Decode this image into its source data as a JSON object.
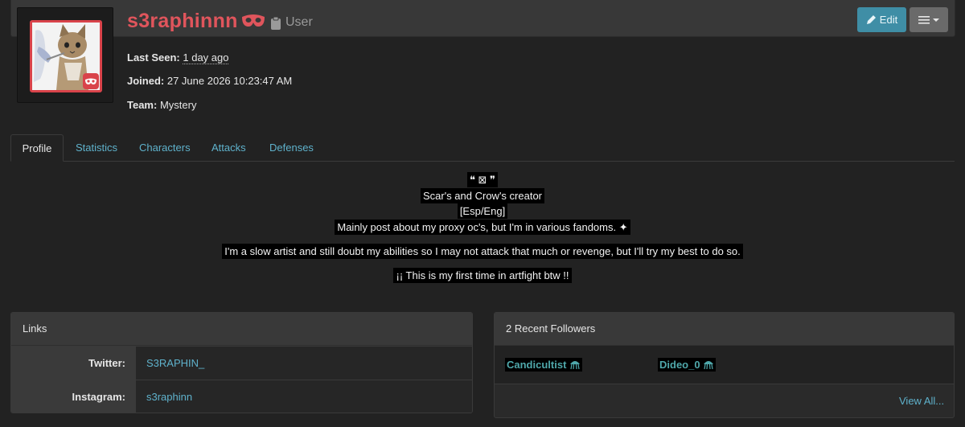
{
  "profile": {
    "username": "s3raphinnn",
    "role": "User",
    "last_seen_label": "Last Seen:",
    "last_seen_value": "1 day ago",
    "joined_label": "Joined:",
    "joined_value": "27 June 2026 10:23:47 AM",
    "team_label": "Team:",
    "team_value": "Mystery"
  },
  "actions": {
    "edit_label": "Edit"
  },
  "tabs": [
    {
      "label": "Profile"
    },
    {
      "label": "Statistics"
    },
    {
      "label": "Characters"
    },
    {
      "label": "Attacks"
    },
    {
      "label": "Defenses"
    }
  ],
  "bio": {
    "line1": "❝ ⊠ ❞",
    "line2": "Scar's and Crow's creator",
    "line3": "[Esp/Eng]",
    "line4": "Mainly post about my proxy oc's, but I'm in various fandoms. ✦",
    "line5": "I'm a slow artist and still doubt my abilities so I may not attack that much or revenge, but I'll try my best to do so.",
    "line6": "¡¡ This is my first time in artfight btw !!"
  },
  "links": {
    "title": "Links",
    "rows": [
      {
        "key": "Twitter:",
        "value": "S3RAPHIN_"
      },
      {
        "key": "Instagram:",
        "value": "s3raphinn"
      }
    ]
  },
  "followers": {
    "title": "2 Recent Followers",
    "items": [
      {
        "name": "Candicultist"
      },
      {
        "name": "Dideo_0"
      }
    ],
    "view_all": "View All..."
  },
  "colors": {
    "accent_red": "#e0555c",
    "link_blue": "#5fb2cc",
    "edit_button": "#3f8ea6"
  },
  "icons": {
    "mystery_team": "mask-icon",
    "role": "clipboard-icon",
    "edit": "pencil-icon",
    "menu": "hamburger-icon",
    "follower_team": "jellyfish-icon"
  }
}
